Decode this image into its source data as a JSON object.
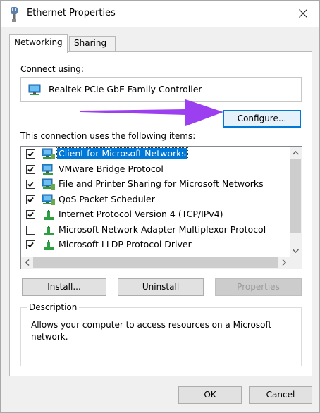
{
  "window": {
    "title": "Ethernet Properties",
    "close_glyph": "×"
  },
  "tabs": [
    {
      "label": "Networking",
      "active": true
    },
    {
      "label": "Sharing",
      "active": false
    }
  ],
  "connect": {
    "label": "Connect using:",
    "adapter_name": "Realtek PCIe GbE Family Controller",
    "adapter_icon": "network-adapter-icon",
    "configure_label": "Configure..."
  },
  "items_label": "This connection uses the following items:",
  "items": [
    {
      "label": "Client for Microsoft Networks",
      "checked": true,
      "selected": true,
      "icon": "network-client-icon"
    },
    {
      "label": "VMware Bridge Protocol",
      "checked": true,
      "selected": false,
      "icon": "network-service-icon"
    },
    {
      "label": "File and Printer Sharing for Microsoft Networks",
      "checked": true,
      "selected": false,
      "icon": "network-client-icon"
    },
    {
      "label": "QoS Packet Scheduler",
      "checked": true,
      "selected": false,
      "icon": "network-client-icon"
    },
    {
      "label": "Internet Protocol Version 4 (TCP/IPv4)",
      "checked": true,
      "selected": false,
      "icon": "protocol-icon"
    },
    {
      "label": "Microsoft Network Adapter Multiplexor Protocol",
      "checked": false,
      "selected": false,
      "icon": "protocol-icon"
    },
    {
      "label": "Microsoft LLDP Protocol Driver",
      "checked": true,
      "selected": false,
      "icon": "protocol-icon"
    }
  ],
  "buttons": {
    "install": "Install...",
    "uninstall": "Uninstall",
    "properties": "Properties",
    "ok": "OK",
    "cancel": "Cancel"
  },
  "description": {
    "legend": "Description",
    "text": "Allows your computer to access resources on a Microsoft network."
  },
  "colors": {
    "selection": "#0078d7",
    "annotation_arrow": "#9b3ff0",
    "focus_border": "#0078d7"
  }
}
